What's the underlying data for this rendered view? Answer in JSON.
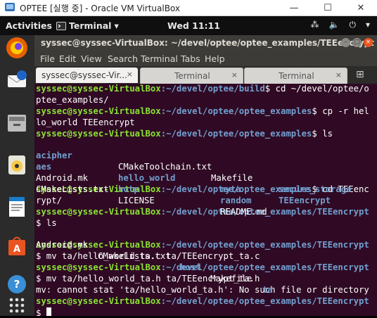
{
  "vbox": {
    "title": "OPTEE [실행 중] - Oracle VM VirtualBox",
    "minimize": "—",
    "maximize": "☐",
    "close": "✕"
  },
  "topbar": {
    "activities": "Activities",
    "app_name": "Terminal",
    "clock": "Wed 11:11",
    "tray_network": "⁂",
    "tray_sound": "🔈",
    "tray_power": "⏻",
    "tray_arrow": "▾"
  },
  "dock": {
    "items": [
      "firefox-icon",
      "thunderbird-icon",
      "files-icon",
      "rhythmbox-icon",
      "writer-icon",
      "software-icon",
      "help-icon",
      "show-apps-icon"
    ]
  },
  "terminal": {
    "title": "syssec@syssec-VirtualBox: ~/devel/optee/optee_examples/TEEencrypt",
    "menu": [
      "File",
      "Edit",
      "View",
      "Search",
      "Terminal",
      "Tabs",
      "Help"
    ],
    "tabs": [
      {
        "label": "syssec@syssec-Vir...",
        "close": "×"
      },
      {
        "label": "Terminal",
        "close": "×"
      },
      {
        "label": "Terminal",
        "close": "×"
      }
    ],
    "new_tab_icon": "⊞"
  },
  "lines": {
    "l1_user": "syssec@syssec-VirtualBox",
    "l1_path": ":~/devel/optee/build",
    "l1_cmd": "$ cd ~/devel/optee/o",
    "l2": "ptee_examples/",
    "l3_user": "syssec@syssec-VirtualBox",
    "l3_path": ":~/devel/optee/optee_examples",
    "l3_cmd": "$ cp -r hel",
    "l4": "lo_world TEEencrypt",
    "l5_user": "syssec@syssec-VirtualBox",
    "l5_path": ":~/devel/optee/optee_examples",
    "l5_cmd": "$ ls",
    "ls1": {
      "a": "acipher",
      "b": "CMakeToolchain.txt",
      "c": "Makefile",
      "d": "secure_storage"
    },
    "ls2": {
      "a": "aes",
      "b": "hello_world",
      "c": "myta",
      "d": "TEEencrypt"
    },
    "ls3": {
      "a": "Android.mk",
      "b": "hotp",
      "c": "random"
    },
    "ls4": {
      "a": "CMakeLists.txt",
      "b": "LICENSE",
      "c": "README.md"
    },
    "l10_user": "syssec@syssec-VirtualBox",
    "l10_path": ":~/devel/optee/optee_examples",
    "l10_cmd": "$ cd TEEenc",
    "l11": "rypt/",
    "l12_user": "syssec@syssec-VirtualBox",
    "l12_path": ":~/devel/optee/optee_examples/TEEencrypt",
    "l13": "$ ls",
    "ls5": {
      "a": "Android.mk",
      "b": "CMakeLists.txt",
      "c": "host",
      "d": "Makefile",
      "e": "ta"
    },
    "l15_user": "syssec@syssec-VirtualBox",
    "l15_path": ":~/devel/optee/optee_examples/TEEencrypt",
    "l16": "$ mv ta/hello_world_ta.c ta/TEEencrypt_ta.c",
    "l17_user": "syssec@syssec-VirtualBox",
    "l17_path": ":~/devel/optee/optee_examples/TEEencrypt",
    "l18": "$ mv ta/hello_world_ta.h ta/TEEencrypt_ta.h",
    "l19": "mv: cannot stat 'ta/hello_world_ta.h': No such file or directory",
    "l20_user": "syssec@syssec-VirtualBox",
    "l20_path": ":~/devel/optee/optee_examples/TEEencrypt",
    "l21": "$ "
  }
}
